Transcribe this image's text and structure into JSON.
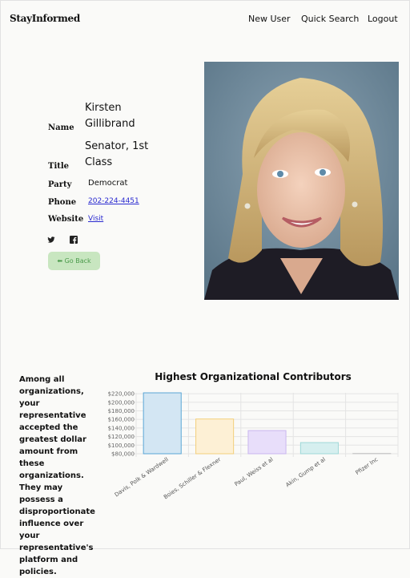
{
  "brand": "StayInformed",
  "nav": {
    "new_user": "New User",
    "quick_search": "Quick Search",
    "logout": "Logout"
  },
  "profile": {
    "labels": {
      "name": "Name",
      "title": "Title",
      "party": "Party",
      "phone": "Phone",
      "website": "Website"
    },
    "name_line1": "Kirsten",
    "name_line2": "Gillibrand",
    "title_line1": "Senator, 1st",
    "title_line2": "Class",
    "party": "Democrat",
    "phone": "202-224-4451",
    "website": "Visit",
    "back_label": "⬅ Go Back"
  },
  "icons": {
    "twitter": "twitter-icon",
    "facebook": "facebook-icon"
  },
  "blurb": "Among all organizations, your representative accepted the greatest dollar amount from these organizations. They may possess a disproportionate influence over your representative's platform and policies.",
  "chart_data": {
    "type": "bar",
    "title": "Highest Organizational Contributors",
    "categories": [
      "Davis, Polk & Wardwell",
      "Boies, Schiller & Flexner",
      "Paul, Weiss et al",
      "Akin, Gump et al",
      "Pfizer Inc"
    ],
    "values": [
      222000,
      161000,
      134000,
      106000,
      81000
    ],
    "ylim": [
      80000,
      222000
    ],
    "yticks": [
      80000,
      100000,
      120000,
      140000,
      160000,
      180000,
      200000,
      220000
    ],
    "ytick_labels": [
      "$80,000",
      "$100,000",
      "$120,000",
      "$140,000",
      "$160,000",
      "$180,000",
      "$200,000",
      "$220,000"
    ],
    "fills": [
      "#d3e6f3",
      "#fdf0d5",
      "#e8defa",
      "#d6efef",
      "#eeeeee"
    ],
    "strokes": [
      "#5aa6d6",
      "#f3cf7c",
      "#c9b6ef",
      "#9fd8d8",
      "#cccccc"
    ]
  }
}
